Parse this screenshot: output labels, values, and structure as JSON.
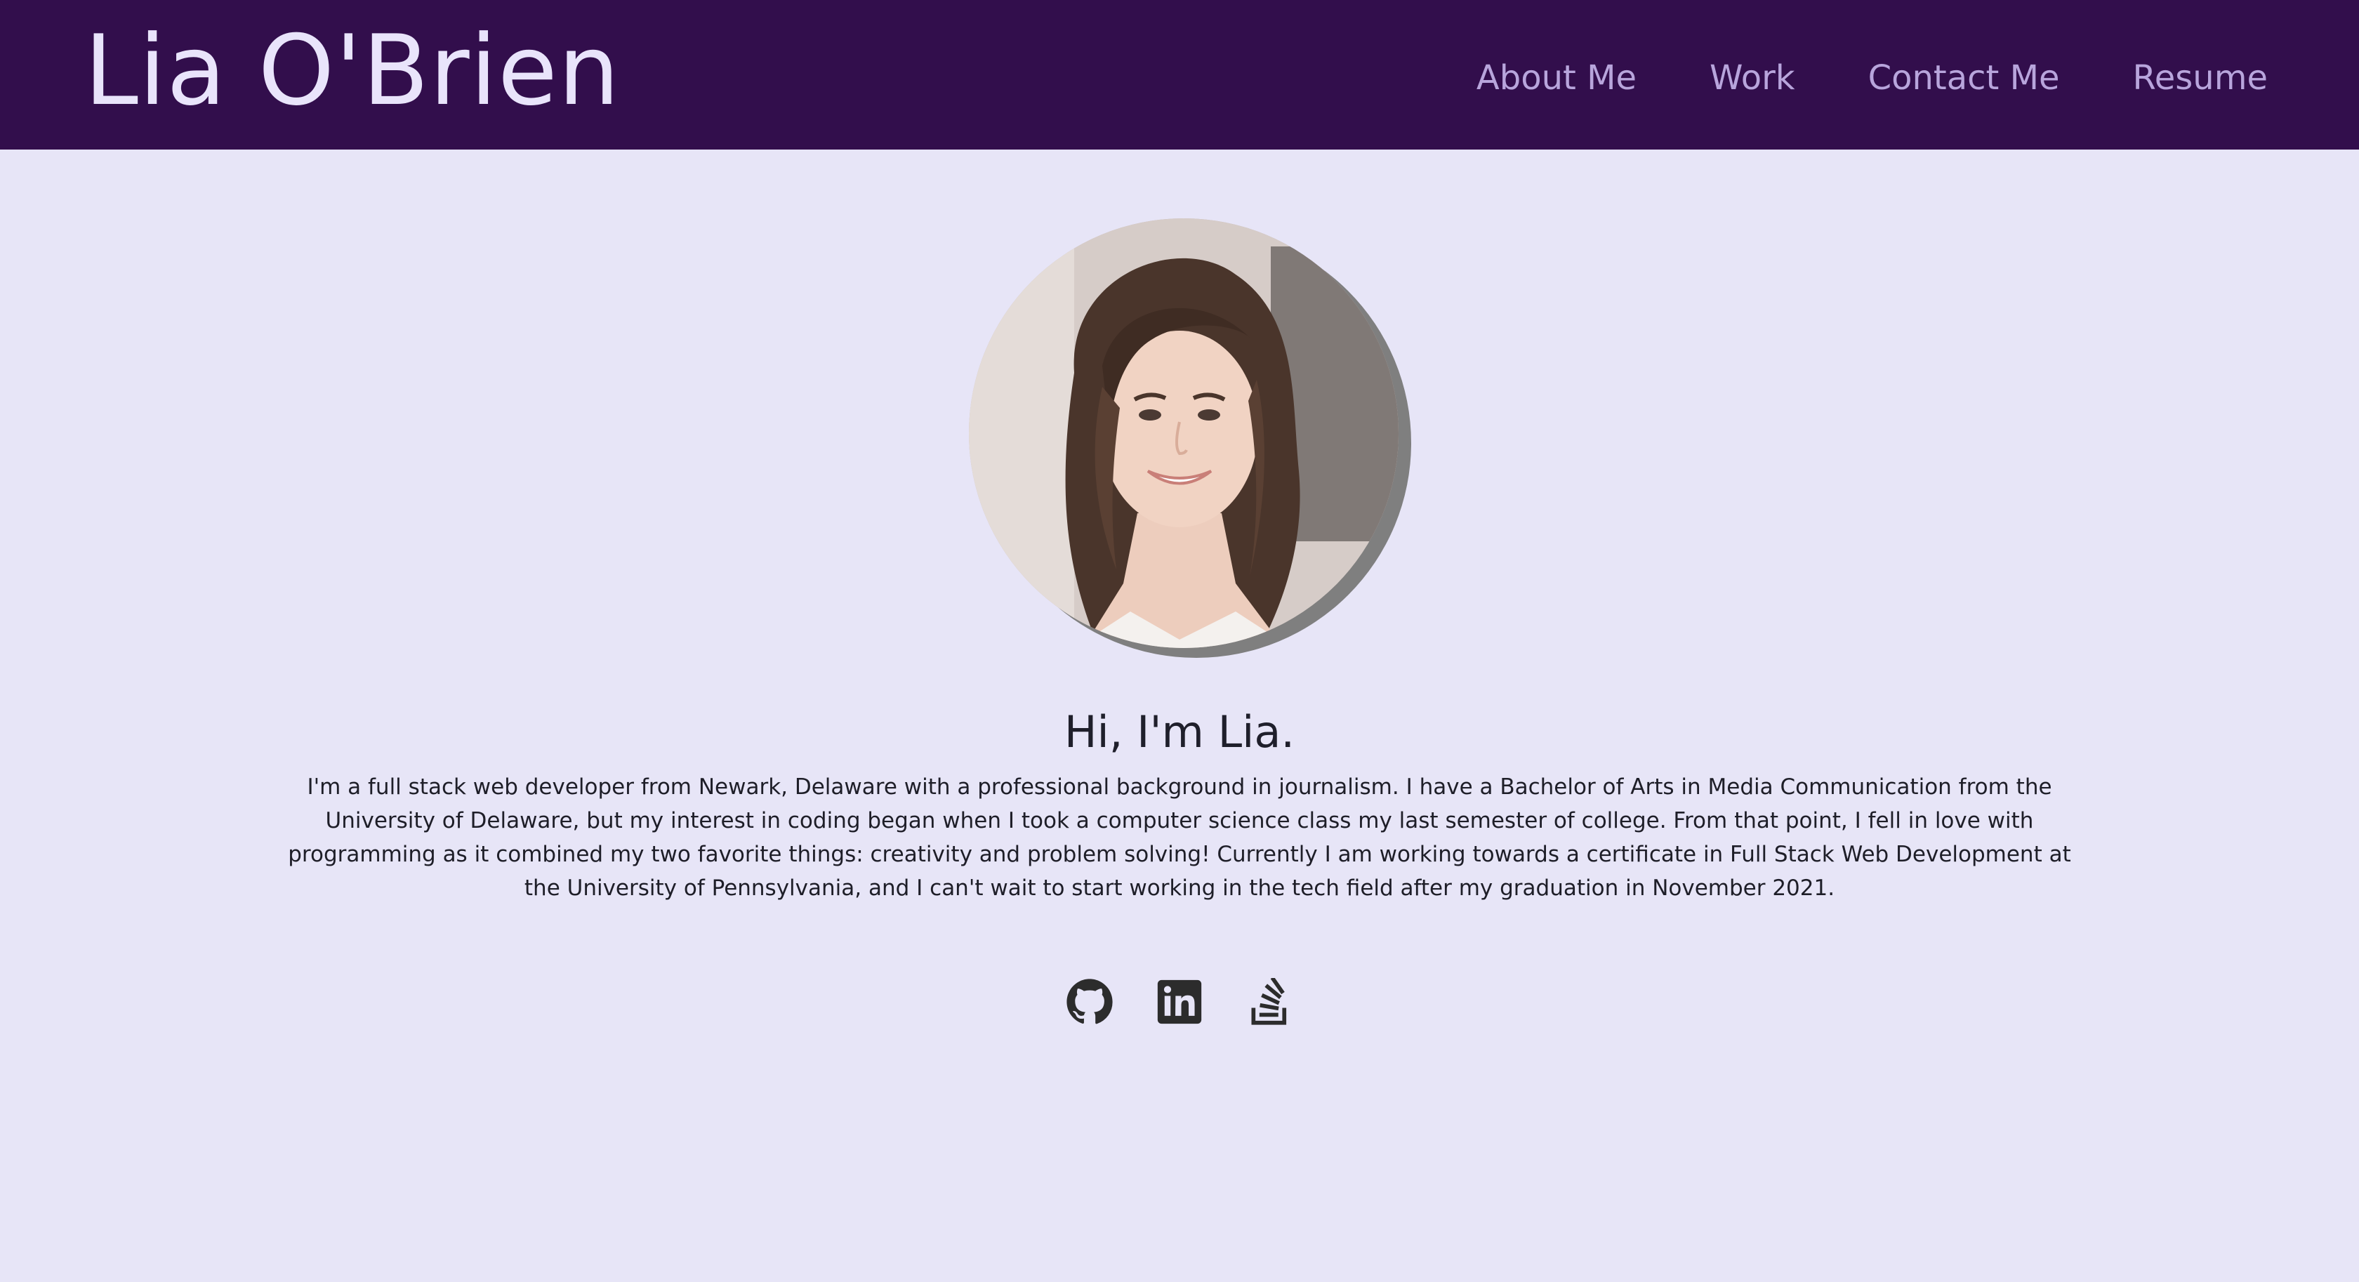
{
  "header": {
    "brand": "Lia O'Brien",
    "nav": [
      {
        "label": "About Me"
      },
      {
        "label": "Work"
      },
      {
        "label": "Contact Me"
      },
      {
        "label": "Resume"
      }
    ]
  },
  "profile": {
    "photo_icon": "profile-photo",
    "greeting": "Hi, I'm Lia.",
    "bio": "I'm a full stack web developer from Newark, Delaware with a professional background in journalism. I have a Bachelor of Arts in Media Communication from the University of Delaware, but my interest in coding began when I took a computer science class my last semester of college. From that point, I fell in love with programming as it combined my two favorite things: creativity and problem solving! Currently I am working towards a certificate in Full Stack Web Development at the University of Pennsylvania, and I can't wait to start working in the tech field after my graduation in November 2021."
  },
  "socials": [
    {
      "icon": "github-icon"
    },
    {
      "icon": "linkedin-icon"
    },
    {
      "icon": "stack-overflow-icon"
    }
  ],
  "colors": {
    "navbar": "#320e4c",
    "brand_text": "#e9e4fb",
    "nav_text": "#b8a5dc",
    "background": "#e7e5f7",
    "body_text": "#1e1e28",
    "icon": "#2c2c2c"
  }
}
